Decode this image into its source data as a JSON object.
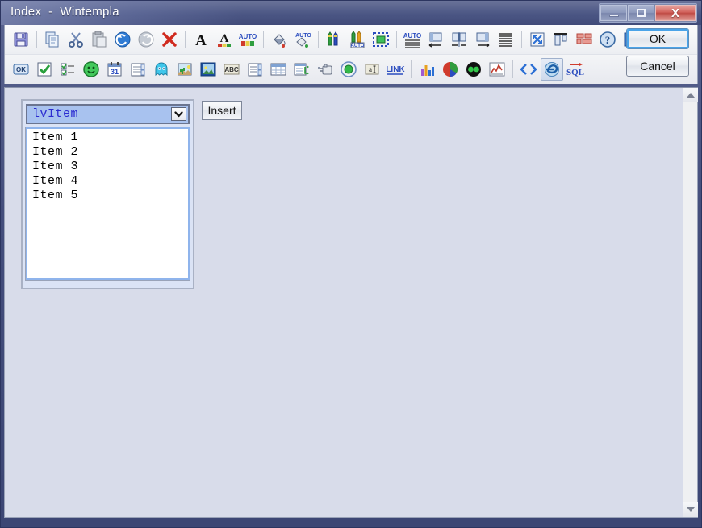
{
  "window": {
    "title": "Index  -  Wintempla",
    "controls": [
      {
        "name": "minimize",
        "glyph": "minimize-icon"
      },
      {
        "name": "maximize",
        "glyph": "maximize-icon"
      },
      {
        "name": "close",
        "glyph": "close-icon",
        "label": "X",
        "color": "#c04b45"
      }
    ]
  },
  "toolbar": {
    "row1": [
      {
        "icon": "save-icon",
        "title": "Save"
      },
      {
        "sep": true
      },
      {
        "icon": "copy-icon",
        "title": "Copy"
      },
      {
        "icon": "cut-icon",
        "title": "Cut"
      },
      {
        "icon": "paste-icon",
        "title": "Paste"
      },
      {
        "icon": "undo-icon",
        "title": "Undo"
      },
      {
        "icon": "redo-icon",
        "title": "Redo"
      },
      {
        "icon": "delete-icon",
        "title": "Delete"
      },
      {
        "sep": true
      },
      {
        "icon": "font-bold-icon",
        "title": "Font"
      },
      {
        "icon": "font-color-icon",
        "title": "Font Color"
      },
      {
        "icon": "auto-color-icon",
        "title": "Auto Color",
        "label": "AUTO"
      },
      {
        "sep": true
      },
      {
        "icon": "fill-bucket-icon",
        "title": "Fill Color"
      },
      {
        "icon": "auto-fill-icon",
        "title": "Auto Fill",
        "label": "AUTO"
      },
      {
        "sep": true
      },
      {
        "icon": "pens-icon",
        "title": "Pens"
      },
      {
        "icon": "pens-auto-icon",
        "title": "Pens Auto",
        "label": "AUTO"
      },
      {
        "icon": "selection-box-icon",
        "title": "Selection"
      },
      {
        "sep": true
      },
      {
        "icon": "auto-lines-icon",
        "title": "Auto Lines",
        "label": "AUTO"
      },
      {
        "icon": "align-left-icon",
        "title": "Align Left"
      },
      {
        "icon": "align-center-icon",
        "title": "Align Center"
      },
      {
        "icon": "align-right-icon",
        "title": "Align Right"
      },
      {
        "icon": "justify-icon",
        "title": "Justify"
      },
      {
        "sep": true
      },
      {
        "icon": "resize-icon",
        "title": "Resize"
      },
      {
        "icon": "align-top-icon",
        "title": "Align Top"
      },
      {
        "icon": "grid-layout-icon",
        "title": "Grid Layout"
      },
      {
        "icon": "help-icon",
        "title": "Help"
      },
      {
        "icon": "info-icon",
        "title": "Info"
      }
    ],
    "row2": [
      {
        "icon": "ok-button-icon",
        "title": "Button",
        "label": "OK"
      },
      {
        "icon": "checkbox-icon",
        "title": "Check Box"
      },
      {
        "icon": "checklist-icon",
        "title": "Check List"
      },
      {
        "icon": "smiley-icon",
        "title": "Smiley"
      },
      {
        "icon": "calendar-icon",
        "title": "Date Picker",
        "label": "31"
      },
      {
        "icon": "spin-list-icon",
        "title": "Spin List"
      },
      {
        "icon": "ghost-icon",
        "title": "Ghost"
      },
      {
        "icon": "image-cactus-icon",
        "title": "Image"
      },
      {
        "icon": "picture-icon",
        "title": "Picture"
      },
      {
        "icon": "abc-icon",
        "title": "Text",
        "label": "ABC"
      },
      {
        "icon": "listbox-icon",
        "title": "List Box"
      },
      {
        "icon": "listview-icon",
        "title": "List View"
      },
      {
        "icon": "table-grid-icon",
        "title": "Grid"
      },
      {
        "icon": "tree-view-icon",
        "title": "Tree View"
      },
      {
        "icon": "database-icon",
        "title": "Database"
      },
      {
        "icon": "radio-button-icon",
        "title": "Radio Button"
      },
      {
        "icon": "text-field-icon",
        "title": "Text Field",
        "label": "a"
      },
      {
        "icon": "link-icon",
        "title": "Link",
        "label": "LINK"
      },
      {
        "sep": true
      },
      {
        "icon": "bar-chart-icon",
        "title": "Bar Chart"
      },
      {
        "icon": "pie-chart-icon",
        "title": "Pie Chart"
      },
      {
        "icon": "circles-icon",
        "title": "Circles"
      },
      {
        "icon": "line-chart-icon",
        "title": "Line Chart"
      },
      {
        "sep": true
      },
      {
        "icon": "code-icon",
        "title": "Code"
      },
      {
        "icon": "browser-icon",
        "title": "Browser",
        "selected": true
      },
      {
        "icon": "sql-icon",
        "title": "SQL",
        "label": "SQL"
      }
    ],
    "ok_label": "OK",
    "cancel_label": "Cancel"
  },
  "form": {
    "combo": {
      "value": "lvItem",
      "arrow": "chevron-down-icon"
    },
    "insert_label": "Insert",
    "list_items": [
      "Item 1",
      "Item 2",
      "Item 3",
      "Item 4",
      "Item 5"
    ]
  },
  "scrollbar": {
    "up": "scroll-up-arrow",
    "down": "scroll-down-arrow"
  }
}
